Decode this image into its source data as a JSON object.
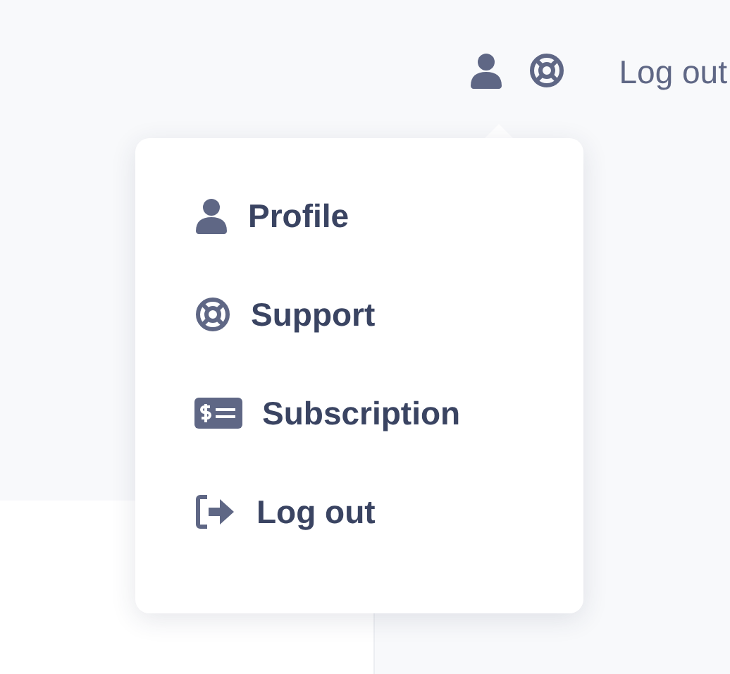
{
  "top_bar": {
    "logout_label": "Log out"
  },
  "menu": {
    "items": [
      {
        "kind": "profile",
        "label": "Profile"
      },
      {
        "kind": "support",
        "label": "Support"
      },
      {
        "kind": "subscription",
        "label": "Subscription"
      },
      {
        "kind": "logout",
        "label": "Log out"
      }
    ]
  }
}
